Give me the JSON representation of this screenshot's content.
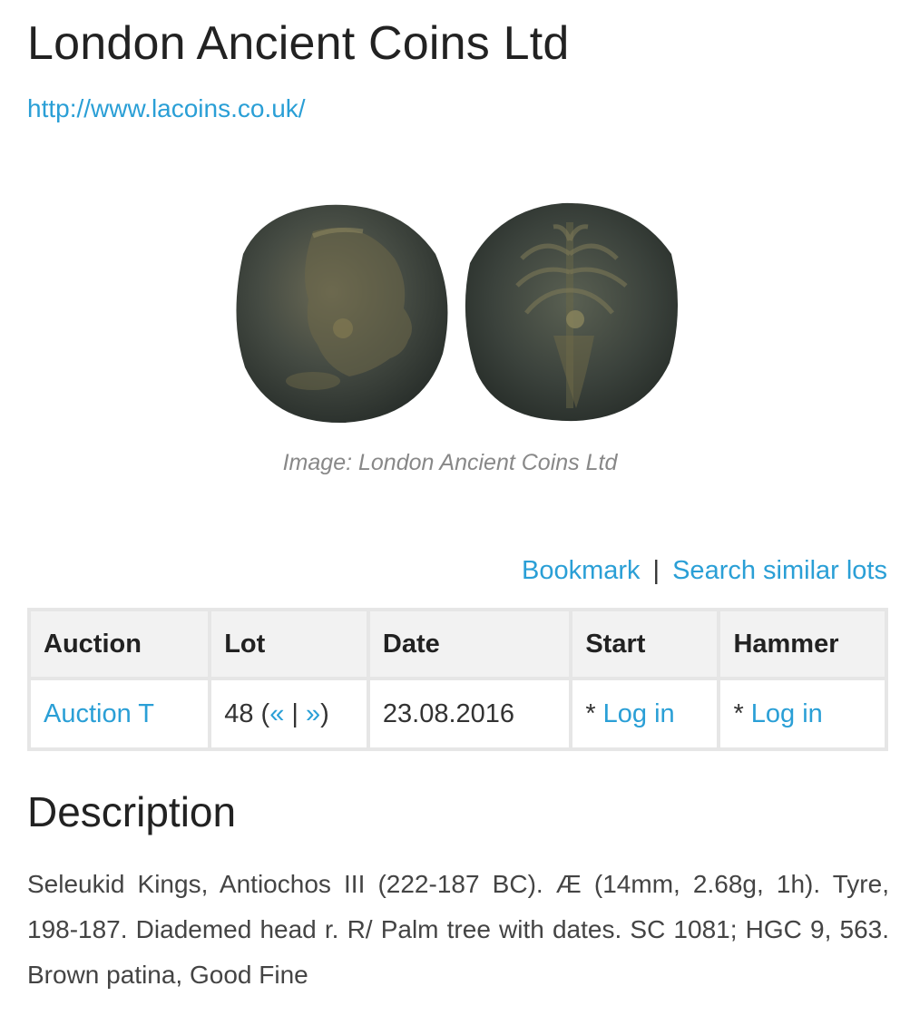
{
  "header": {
    "title": "London Ancient Coins Ltd",
    "website": "http://www.lacoins.co.uk/"
  },
  "image": {
    "caption": "Image: London Ancient Coins Ltd"
  },
  "actions": {
    "bookmark": "Bookmark",
    "separator": "|",
    "search_similar": "Search similar lots"
  },
  "table": {
    "headers": [
      "Auction",
      "Lot",
      "Date",
      "Start",
      "Hammer"
    ],
    "row": {
      "auction": "Auction T",
      "lot_number": "48",
      "lot_open": " (",
      "prev": "«",
      "lot_sep": " | ",
      "next": "»",
      "lot_close": ")",
      "date": "23.08.2016",
      "start_prefix": "* ",
      "start_link": "Log in",
      "hammer_prefix": "* ",
      "hammer_link": "Log in"
    }
  },
  "description": {
    "title": "Description",
    "text": "Seleukid Kings, Antiochos III (222-187 BC). Æ (14mm, 2.68g, 1h). Tyre, 198-187. Diademed head r. R/ Palm tree with dates. SC 1081; HGC 9, 563. Brown patina, Good Fine"
  },
  "colors": {
    "link": "#2a9fd6",
    "coin": "#3f4740"
  }
}
